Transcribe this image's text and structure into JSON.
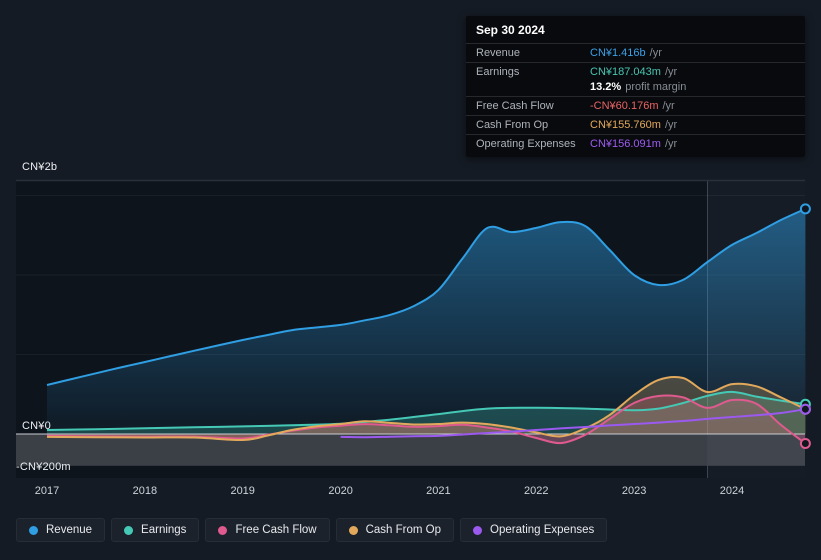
{
  "tooltip": {
    "date": "Sep 30 2024",
    "rows": [
      {
        "label": "Revenue",
        "value": "CN¥1.416b",
        "suffix": "/yr",
        "value_color": "#3ba1e8"
      },
      {
        "label": "Earnings",
        "value": "CN¥187.043m",
        "suffix": "/yr",
        "value_color": "#49c5b1"
      },
      {
        "label": "Free Cash Flow",
        "value": "-CN¥60.176m",
        "suffix": "/yr",
        "value_color": "#e86464"
      },
      {
        "label": "Cash From Op",
        "value": "CN¥155.760m",
        "suffix": "/yr",
        "value_color": "#e3a95c"
      },
      {
        "label": "Operating Expenses",
        "value": "CN¥156.091m",
        "suffix": "/yr",
        "value_color": "#9d5cf2"
      }
    ],
    "profit_margin": {
      "percent": "13.2%",
      "text": "profit margin"
    }
  },
  "chart_data": {
    "type": "area",
    "unit": "CN¥ millions per year",
    "x_labels": [
      "2017",
      "2018",
      "2019",
      "2020",
      "2021",
      "2022",
      "2023",
      "2024"
    ],
    "y_axis_labels": [
      "CN¥2b",
      "CN¥0",
      "-CN¥200m"
    ],
    "x_range": [
      2017,
      2024.75
    ],
    "grid": true,
    "legend_position": "bottom-left",
    "highlight_band_start": 2023.75,
    "series": [
      {
        "name": "Revenue",
        "color": "#2f9ee3",
        "fill": "gradient",
        "points": [
          [
            2017,
            308
          ],
          [
            2017.25,
            345
          ],
          [
            2017.5,
            382
          ],
          [
            2017.75,
            418
          ],
          [
            2018,
            453
          ],
          [
            2018.25,
            488
          ],
          [
            2018.5,
            523
          ],
          [
            2018.75,
            557
          ],
          [
            2019,
            591
          ],
          [
            2019.25,
            622
          ],
          [
            2019.5,
            653
          ],
          [
            2019.75,
            670
          ],
          [
            2020,
            686
          ],
          [
            2020.25,
            715
          ],
          [
            2020.5,
            748
          ],
          [
            2020.75,
            805
          ],
          [
            2021,
            906
          ],
          [
            2021.25,
            1107
          ],
          [
            2021.5,
            1296
          ],
          [
            2021.75,
            1270
          ],
          [
            2022,
            1296
          ],
          [
            2022.25,
            1333
          ],
          [
            2022.5,
            1308
          ],
          [
            2022.75,
            1157
          ],
          [
            2023,
            1000
          ],
          [
            2023.25,
            937
          ],
          [
            2023.5,
            969
          ],
          [
            2023.75,
            1082
          ],
          [
            2024,
            1189
          ],
          [
            2024.25,
            1264
          ],
          [
            2024.5,
            1346
          ],
          [
            2024.75,
            1416
          ]
        ]
      },
      {
        "name": "Earnings",
        "color": "#45c8b5",
        "fill": "solid",
        "points": [
          [
            2017,
            25
          ],
          [
            2017.5,
            30
          ],
          [
            2018,
            36
          ],
          [
            2018.5,
            42
          ],
          [
            2019,
            48
          ],
          [
            2019.5,
            55
          ],
          [
            2020,
            65
          ],
          [
            2020.5,
            90
          ],
          [
            2021,
            125
          ],
          [
            2021.5,
            160
          ],
          [
            2022,
            165
          ],
          [
            2022.5,
            160
          ],
          [
            2023,
            150
          ],
          [
            2023.25,
            160
          ],
          [
            2023.5,
            195
          ],
          [
            2023.75,
            240
          ],
          [
            2024,
            265
          ],
          [
            2024.25,
            235
          ],
          [
            2024.5,
            210
          ],
          [
            2024.75,
            187
          ]
        ]
      },
      {
        "name": "Free Cash Flow",
        "color": "#df5a8e",
        "fill": "solid",
        "points": [
          [
            2017,
            -12
          ],
          [
            2017.5,
            -15
          ],
          [
            2018,
            -17
          ],
          [
            2018.5,
            -17
          ],
          [
            2019,
            -28
          ],
          [
            2019.25,
            -5
          ],
          [
            2019.5,
            20
          ],
          [
            2019.75,
            40
          ],
          [
            2020,
            52
          ],
          [
            2020.25,
            62
          ],
          [
            2020.5,
            55
          ],
          [
            2020.75,
            45
          ],
          [
            2021,
            50
          ],
          [
            2021.25,
            58
          ],
          [
            2021.5,
            40
          ],
          [
            2021.75,
            15
          ],
          [
            2022,
            -25
          ],
          [
            2022.25,
            -57
          ],
          [
            2022.5,
            -5
          ],
          [
            2022.75,
            95
          ],
          [
            2023,
            195
          ],
          [
            2023.25,
            239
          ],
          [
            2023.5,
            230
          ],
          [
            2023.75,
            164
          ],
          [
            2024,
            214
          ],
          [
            2024.25,
            190
          ],
          [
            2024.5,
            57
          ],
          [
            2024.75,
            -60
          ]
        ]
      },
      {
        "name": "Cash From Op",
        "color": "#e2a95c",
        "fill": "solid",
        "points": [
          [
            2017,
            -18
          ],
          [
            2017.5,
            -20
          ],
          [
            2018,
            -22
          ],
          [
            2018.5,
            -22
          ],
          [
            2019,
            -38
          ],
          [
            2019.25,
            -10
          ],
          [
            2019.5,
            25
          ],
          [
            2019.75,
            48
          ],
          [
            2020,
            63
          ],
          [
            2020.25,
            80
          ],
          [
            2020.5,
            70
          ],
          [
            2020.75,
            60
          ],
          [
            2021,
            63
          ],
          [
            2021.25,
            72
          ],
          [
            2021.5,
            62
          ],
          [
            2021.75,
            40
          ],
          [
            2022,
            10
          ],
          [
            2022.25,
            -15
          ],
          [
            2022.5,
            35
          ],
          [
            2022.75,
            120
          ],
          [
            2023,
            245
          ],
          [
            2023.25,
            340
          ],
          [
            2023.5,
            352
          ],
          [
            2023.75,
            264
          ],
          [
            2024,
            314
          ],
          [
            2024.25,
            300
          ],
          [
            2024.5,
            230
          ],
          [
            2024.75,
            156
          ]
        ]
      },
      {
        "name": "Operating Expenses",
        "color": "#9b59f0",
        "fill": "none",
        "points": [
          [
            2020,
            -18
          ],
          [
            2020.25,
            -20
          ],
          [
            2020.5,
            -17
          ],
          [
            2020.75,
            -14
          ],
          [
            2021,
            -12
          ],
          [
            2021.25,
            -3
          ],
          [
            2021.5,
            6
          ],
          [
            2021.75,
            15
          ],
          [
            2022,
            25
          ],
          [
            2022.25,
            35
          ],
          [
            2022.5,
            44
          ],
          [
            2022.75,
            54
          ],
          [
            2023,
            63
          ],
          [
            2023.25,
            72
          ],
          [
            2023.5,
            82
          ],
          [
            2023.75,
            95
          ],
          [
            2024,
            107
          ],
          [
            2024.25,
            118
          ],
          [
            2024.5,
            132
          ],
          [
            2024.75,
            156
          ]
        ]
      }
    ]
  }
}
